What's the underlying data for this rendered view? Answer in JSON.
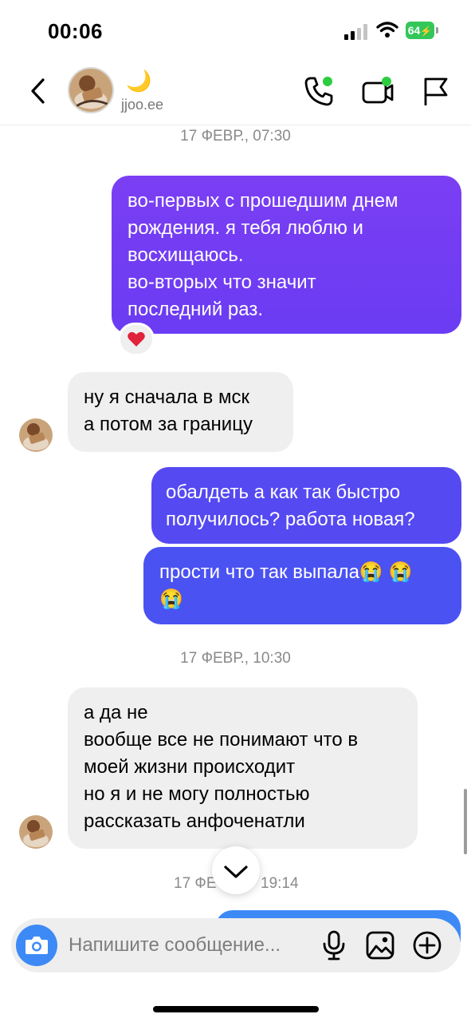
{
  "status": {
    "time": "00:06",
    "battery": "64"
  },
  "header": {
    "moon": "🌙",
    "username": "jjoo.ee"
  },
  "messages": {
    "ts1": "17 ФЕВР., 07:30",
    "m1": [
      "во-первых с прошедшим днем",
      "рождения. я тебя люблю и",
      "восхищаюсь.",
      "во-вторых что значит",
      "последний раз."
    ],
    "m1_reaction": "❤️",
    "m2": [
      "ну я сначала в мск",
      "а потом за границу"
    ],
    "m3": [
      "обалдеть а как так быстро",
      "получилось? работа новая?"
    ],
    "m4": [
      "прости что так выпала😭 😭",
      "😭"
    ],
    "ts2": "17 ФЕВР., 10:30",
    "m5": [
      "а да не",
      "вообще все не понимают что в",
      "моей жизни происходит",
      "но я и не могу полностью",
      "рассказать анфоченатли"
    ],
    "ts3_left": "17 ФЕ",
    "ts3_right": "19:14"
  },
  "composer": {
    "placeholder": "Напишите сообщение..."
  },
  "icons": {
    "back": "chevron-left-icon",
    "call": "phone-icon",
    "video": "video-camera-icon",
    "report": "flag-icon",
    "scroll_down": "chevron-down-icon",
    "camera": "camera-icon",
    "mic": "microphone-icon",
    "gallery": "image-icon",
    "add": "plus-circle-icon"
  },
  "colors": {
    "bubble_purple": "#7a3cf2",
    "bubble_blue": "#4b51f2",
    "incoming": "#efefef",
    "active_dot": "#2ecc40",
    "camera_button": "#3d8af7"
  }
}
